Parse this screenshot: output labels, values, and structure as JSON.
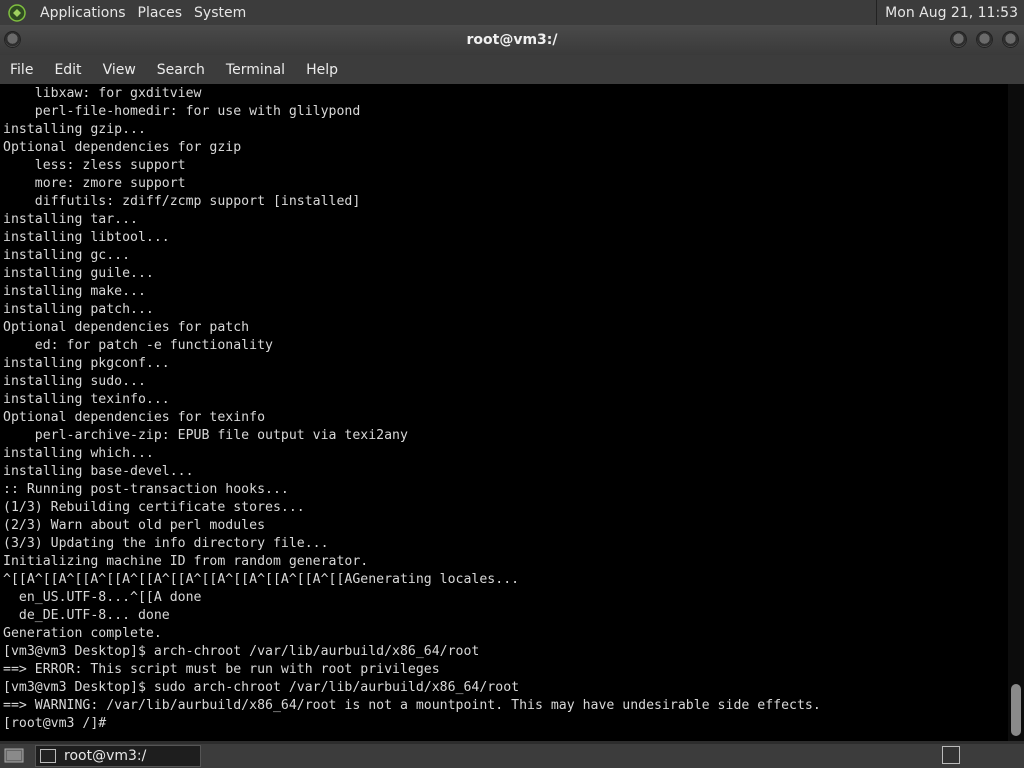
{
  "top_panel": {
    "menus": [
      "Applications",
      "Places",
      "System"
    ],
    "clock": "Mon Aug 21, 11:53"
  },
  "window": {
    "title": "root@vm3:/"
  },
  "menubar": {
    "items": [
      "File",
      "Edit",
      "View",
      "Search",
      "Terminal",
      "Help"
    ]
  },
  "terminal": {
    "lines": [
      "    libxaw: for gxditview",
      "    perl-file-homedir: for use with glilypond",
      "installing gzip...",
      "Optional dependencies for gzip",
      "    less: zless support",
      "    more: zmore support",
      "    diffutils: zdiff/zcmp support [installed]",
      "installing tar...",
      "installing libtool...",
      "installing gc...",
      "installing guile...",
      "installing make...",
      "installing patch...",
      "Optional dependencies for patch",
      "    ed: for patch -e functionality",
      "installing pkgconf...",
      "installing sudo...",
      "installing texinfo...",
      "Optional dependencies for texinfo",
      "    perl-archive-zip: EPUB file output via texi2any",
      "installing which...",
      "installing base-devel...",
      ":: Running post-transaction hooks...",
      "(1/3) Rebuilding certificate stores...",
      "(2/3) Warn about old perl modules",
      "(3/3) Updating the info directory file...",
      "Initializing machine ID from random generator.",
      "^[[A^[[A^[[A^[[A^[[A^[[A^[[A^[[A^[[A^[[A^[[AGenerating locales...",
      "  en_US.UTF-8...^[[A done",
      "  de_DE.UTF-8... done",
      "Generation complete.",
      "[vm3@vm3 Desktop]$ arch-chroot /var/lib/aurbuild/x86_64/root",
      "==> ERROR: This script must be run with root privileges",
      "[vm3@vm3 Desktop]$ sudo arch-chroot /var/lib/aurbuild/x86_64/root",
      "==> WARNING: /var/lib/aurbuild/x86_64/root is not a mountpoint. This may have undesirable side effects.",
      "[root@vm3 /]#"
    ]
  },
  "taskbar": {
    "task_label": "root@vm3:/"
  }
}
